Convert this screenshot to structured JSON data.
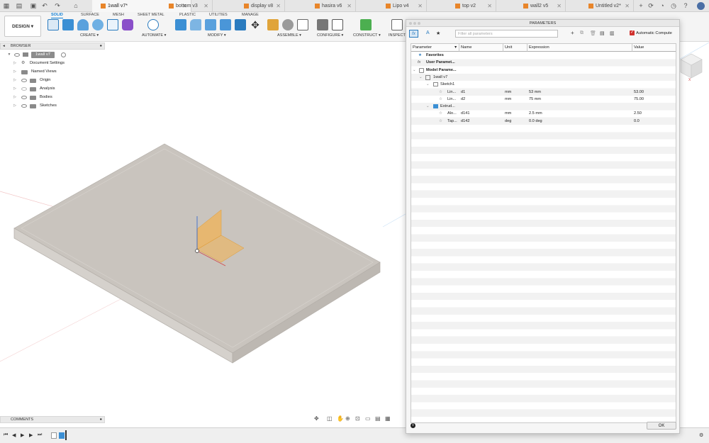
{
  "app": {
    "tabs": [
      {
        "label": "1wall v7*",
        "active": true
      },
      {
        "label": "bottom v3"
      },
      {
        "label": "display v8"
      },
      {
        "label": "hasira v6"
      },
      {
        "label": "Lipo v4"
      },
      {
        "label": "top v2"
      },
      {
        "label": "wall2 v5"
      },
      {
        "label": "Untitled v2*"
      }
    ]
  },
  "ribbon": {
    "workspace": "DESIGN ▾",
    "tabs": [
      "SOLID",
      "SURFACE",
      "MESH",
      "SHEET METAL",
      "PLASTIC",
      "UTILITIES",
      "MANAGE"
    ],
    "groups": [
      "CREATE ▾",
      "AUTOMATE ▾",
      "MODIFY ▾",
      "ASSEMBLE ▾",
      "CONFIGURE ▾",
      "CONSTRUCT ▾",
      "INSPECT"
    ]
  },
  "browser": {
    "title": "BROWSER",
    "root": "1wall v7",
    "items": [
      "Document Settings",
      "Named Views",
      "Origin",
      "Analysis",
      "Bodies",
      "Sketches"
    ]
  },
  "comments": {
    "title": "COMMENTS"
  },
  "params": {
    "title": "PARAMETERS",
    "filter_placeholder": "Filter all parameters",
    "auto_compute": "Automatic Compute",
    "columns": [
      "Parameter",
      "Name",
      "Unit",
      "Expression",
      "Value"
    ],
    "tree": {
      "favorites": "Favorites",
      "user": "User Paramet...",
      "model": "Model Parame...",
      "component": "1wall v7",
      "sketch": "Sketch1",
      "extrude": "Extrud..."
    },
    "rows": [
      {
        "param": "Lin...",
        "name": "d1",
        "unit": "mm",
        "expr": "53 mm",
        "value": "53.00"
      },
      {
        "param": "Lin...",
        "name": "d2",
        "unit": "mm",
        "expr": "75 mm",
        "value": "75.00"
      },
      {
        "param": "Alo...",
        "name": "d141",
        "unit": "mm",
        "expr": "2.5 mm",
        "value": "2.50"
      },
      {
        "param": "Tap...",
        "name": "d142",
        "unit": "deg",
        "expr": "0.0 deg",
        "value": "0.0"
      }
    ],
    "ok_label": "OK"
  },
  "colors": {
    "accent": "#0f7fd6",
    "checkbox": "#d0312d",
    "doc_icon": "#e8852a",
    "plate": "#c9c4be",
    "sketch_fill": "#f3b24e"
  }
}
